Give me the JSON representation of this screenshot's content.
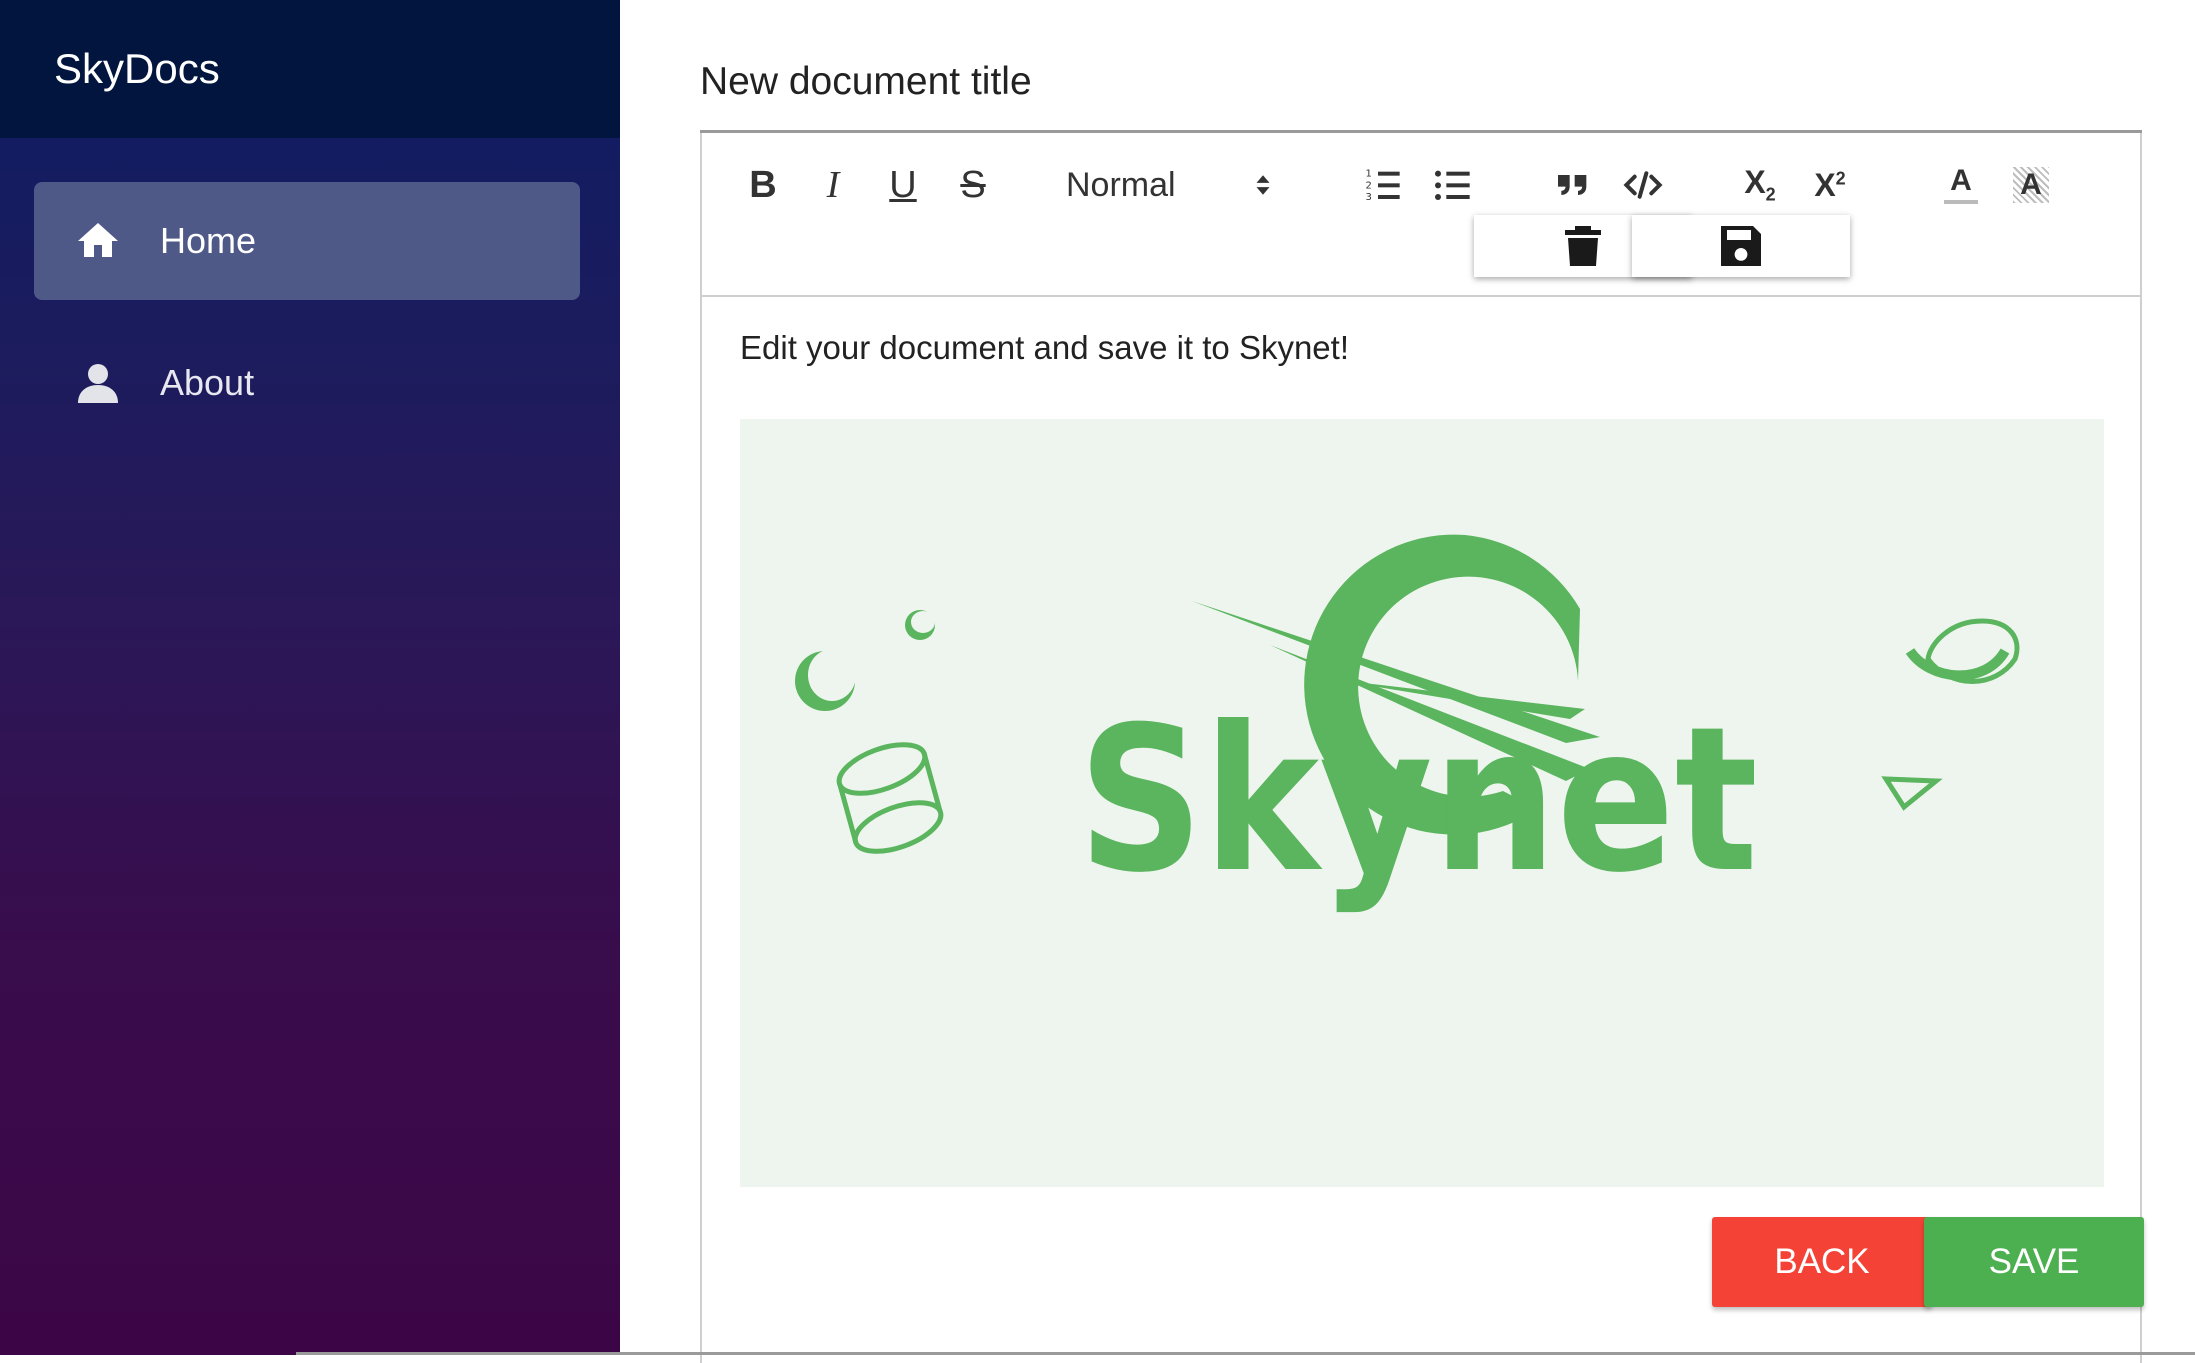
{
  "app": {
    "brand": "SkyDocs"
  },
  "sidebar": {
    "items": [
      {
        "label": "Home",
        "icon": "home-icon",
        "active": true
      },
      {
        "label": "About",
        "icon": "user-icon",
        "active": false
      }
    ]
  },
  "document": {
    "title": "New document title",
    "body_text": "Edit your document and save it to Skynet!",
    "image_logo_text": "Skynet"
  },
  "toolbar": {
    "bold": "B",
    "italic": "I",
    "underline": "U",
    "strike": "S",
    "header_select": "Normal",
    "subscript_base": "X",
    "subscript_mark": "2",
    "superscript_base": "X",
    "superscript_mark": "2",
    "color_letter": "A",
    "background_letter": "A"
  },
  "buttons": {
    "back": "BACK",
    "save": "SAVE"
  },
  "colors": {
    "sidebar_header": "#02153e",
    "active_nav": "#4f5988",
    "back_button": "#f44336",
    "save_button": "#4caf50",
    "logo_green": "#5ab55e"
  }
}
